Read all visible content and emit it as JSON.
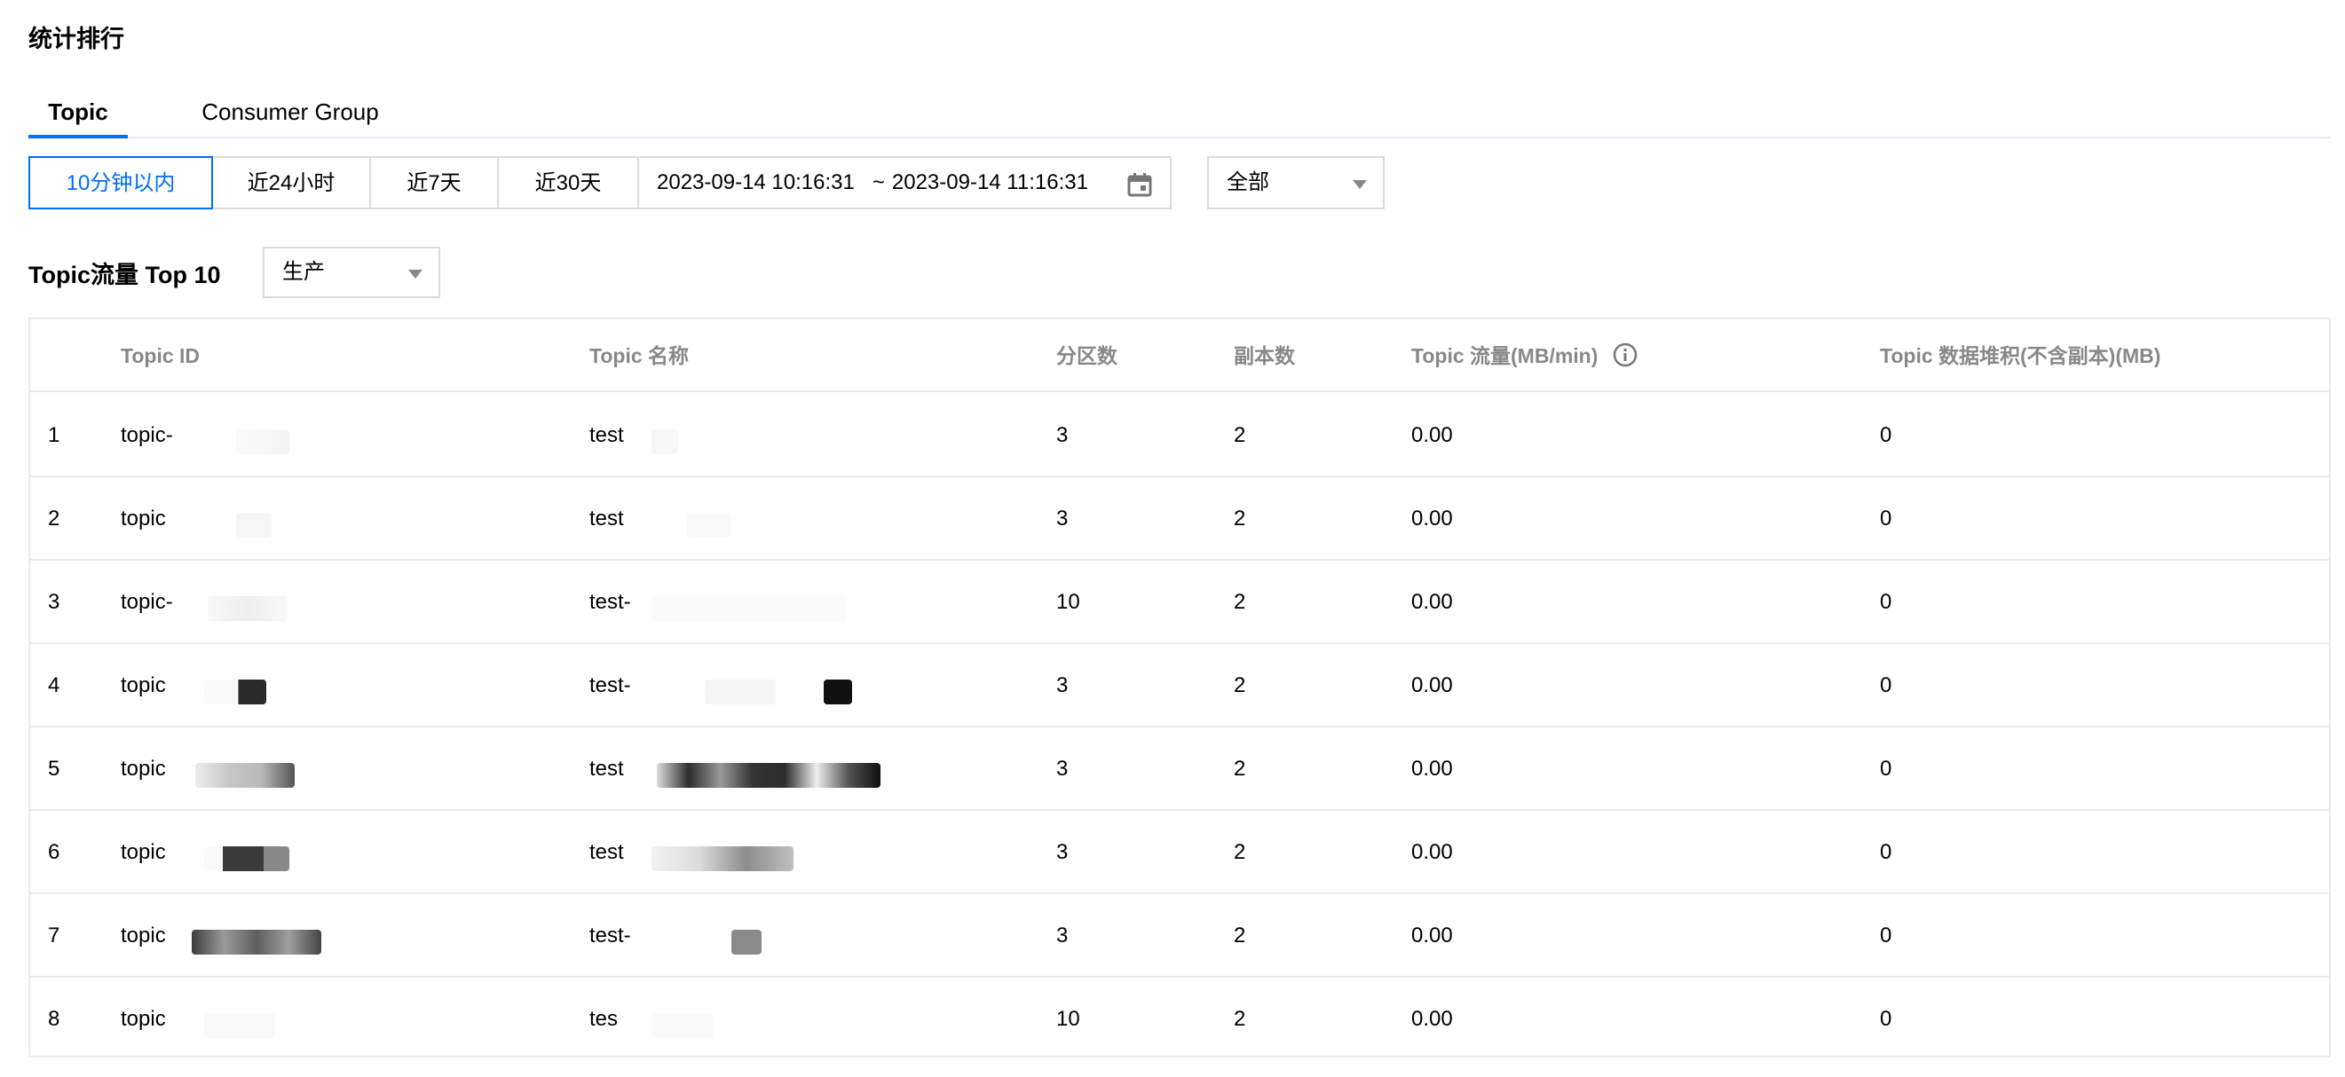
{
  "section_title": "统计排行",
  "tabs": [
    {
      "label": "Topic",
      "active": true
    },
    {
      "label": "Consumer Group",
      "active": false
    }
  ],
  "time_buttons": [
    {
      "label": "10分钟以内",
      "active": true
    },
    {
      "label": "近24小时",
      "active": false
    },
    {
      "label": "近7天",
      "active": false
    },
    {
      "label": "近30天",
      "active": false
    }
  ],
  "date_range": {
    "start": "2023-09-14 10:16:31",
    "separator": "~",
    "end": "2023-09-14 11:16:31"
  },
  "scope_select": {
    "value": "全部"
  },
  "top_section": {
    "title": "Topic流量 Top 10",
    "mode_select": {
      "value": "生产"
    }
  },
  "table": {
    "columns": [
      "Topic ID",
      "Topic 名称",
      "分区数",
      "副本数",
      "Topic 流量(MB/min)",
      "Topic 数据堆积(不含副本)(MB)"
    ],
    "rows": [
      {
        "rank": "1",
        "id": "topic-",
        "name": "test",
        "partitions": "3",
        "replicas": "2",
        "traffic": "0.00",
        "backlog": "0"
      },
      {
        "rank": "2",
        "id": "topic",
        "name": "test",
        "partitions": "3",
        "replicas": "2",
        "traffic": "0.00",
        "backlog": "0"
      },
      {
        "rank": "3",
        "id": "topic-",
        "name": "test-",
        "partitions": "10",
        "replicas": "2",
        "traffic": "0.00",
        "backlog": "0"
      },
      {
        "rank": "4",
        "id": "topic",
        "name": "test-",
        "partitions": "3",
        "replicas": "2",
        "traffic": "0.00",
        "backlog": "0"
      },
      {
        "rank": "5",
        "id": "topic",
        "name": "test",
        "partitions": "3",
        "replicas": "2",
        "traffic": "0.00",
        "backlog": "0"
      },
      {
        "rank": "6",
        "id": "topic",
        "name": "test",
        "partitions": "3",
        "replicas": "2",
        "traffic": "0.00",
        "backlog": "0"
      },
      {
        "rank": "7",
        "id": "topic",
        "name": "test-",
        "partitions": "3",
        "replicas": "2",
        "traffic": "0.00",
        "backlog": "0"
      },
      {
        "rank": "8",
        "id": "topic",
        "name": "tes",
        "partitions": "10",
        "replicas": "2",
        "traffic": "0.00",
        "backlog": "0"
      }
    ]
  },
  "icons": {
    "calendar": "calendar-icon",
    "info": "info-icon",
    "dropdown": "caret-down-icon"
  },
  "colors": {
    "accent": "#006eff",
    "border": "#dcdcdc",
    "header_text": "#888888"
  }
}
